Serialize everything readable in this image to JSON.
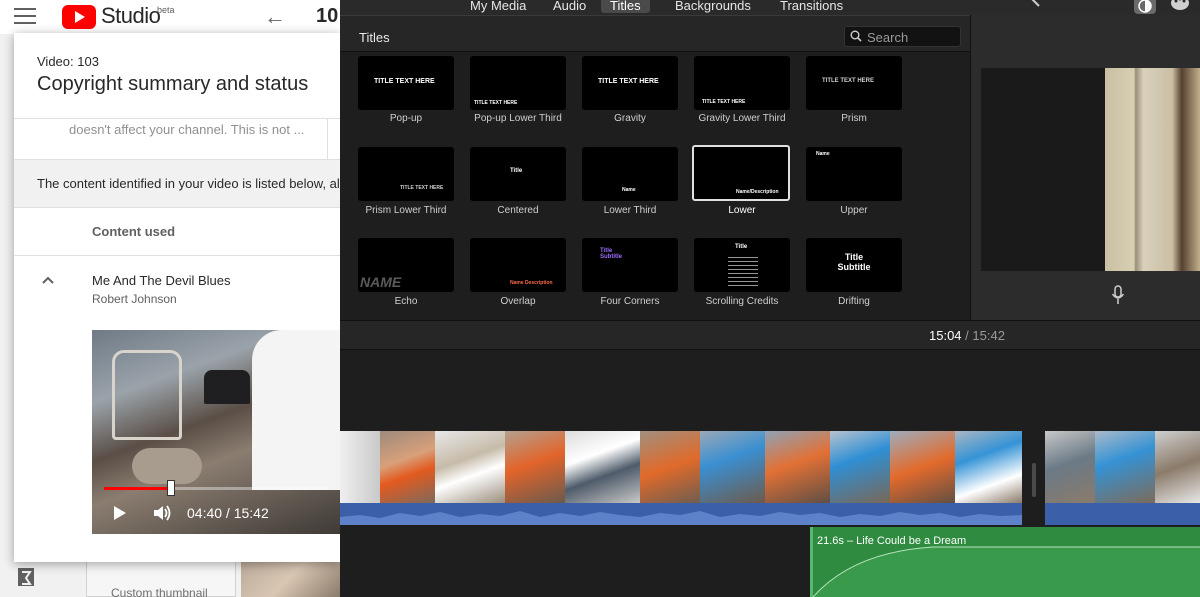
{
  "yt": {
    "app_name": "Studio",
    "beta": "beta",
    "video_number_partial": "10",
    "custom_thumbnail": "Custom thumbnail"
  },
  "modal": {
    "video_label": "Video: 103",
    "title": "Copyright summary and status",
    "faded_text": "doesn't affect your channel. This is not ...",
    "info_text": "The content identified in your video is listed below, alo",
    "column_header": "Content used",
    "song": "Me And The Devil Blues",
    "artist": "Robert Johnson",
    "player": {
      "time": "04:40 / 15:42",
      "progress": 0.3
    }
  },
  "imovie": {
    "tabs": [
      "My Media",
      "Audio",
      "Titles",
      "Backgrounds",
      "Transitions"
    ],
    "active_tab": "Titles",
    "browser_title": "Titles",
    "search_placeholder": "Search",
    "titles": [
      {
        "label": "Pop-up",
        "preview": "TITLE TEXT HERE"
      },
      {
        "label": "Pop-up Lower Third",
        "preview": "TITLE TEXT HERE"
      },
      {
        "label": "Gravity",
        "preview": "TITLE TEXT HERE"
      },
      {
        "label": "Gravity Lower Third",
        "preview": "TITLE TEXT HERE"
      },
      {
        "label": "Prism",
        "preview": "TITLE TEXT HERE"
      },
      {
        "label": "Prism Lower Third",
        "preview": "TITLE TEXT HERE"
      },
      {
        "label": "Centered",
        "preview": "Title"
      },
      {
        "label": "Lower Third",
        "preview": "Name"
      },
      {
        "label": "Lower",
        "preview": "Name/Description"
      },
      {
        "label": "Upper",
        "preview": "Name"
      },
      {
        "label": "Echo",
        "preview": "NAME"
      },
      {
        "label": "Overlap",
        "preview": "Name Description"
      },
      {
        "label": "Four Corners",
        "preview": "Title Subtitle"
      },
      {
        "label": "Scrolling Credits",
        "preview": "Title"
      },
      {
        "label": "Drifting",
        "preview": "Title Subtitle"
      }
    ],
    "selected_title": "Lower",
    "timecode": "15:04",
    "separator": "/",
    "duration": "15:42",
    "music_clip": "21.6s – Life Could be a Dream",
    "colors": {
      "audio": "#3b5fa8",
      "music": "#2e8b3f",
      "accent_red": "#ff0000"
    }
  }
}
